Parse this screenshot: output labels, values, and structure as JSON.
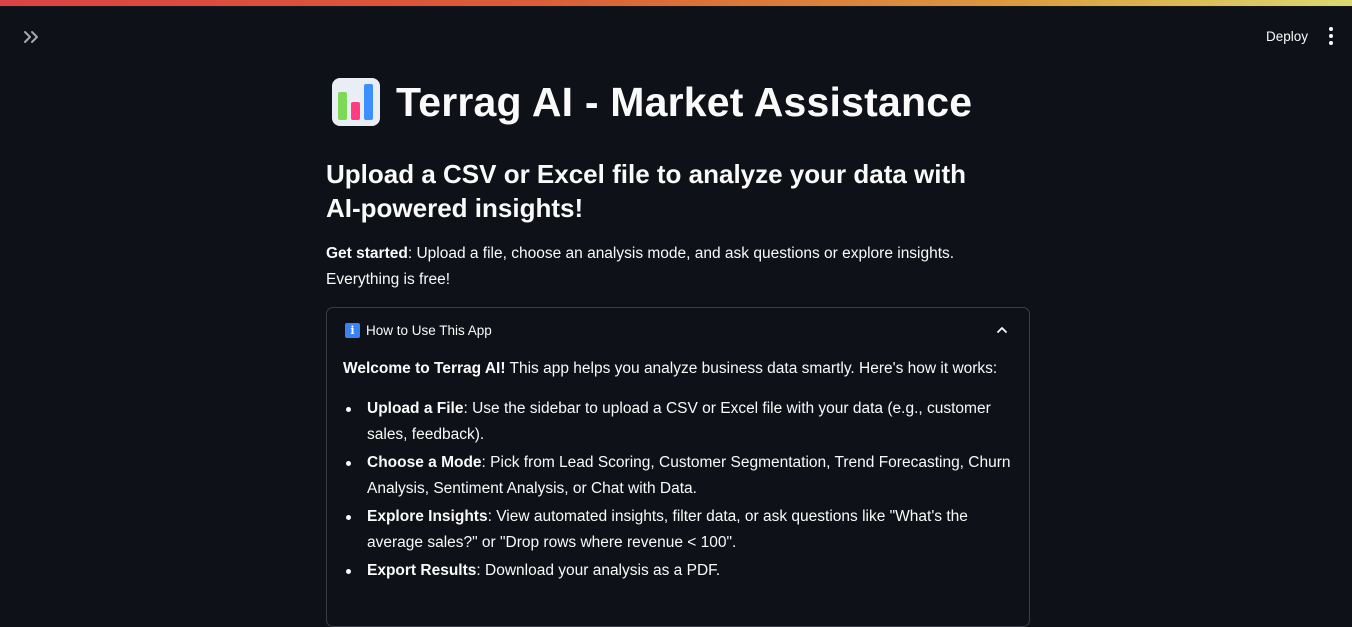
{
  "header": {
    "deploy_label": "Deploy"
  },
  "page": {
    "title": "Terrag AI - Market Assistance",
    "subtitle": "Upload a CSV or Excel file to analyze your data with AI-powered insights!",
    "intro_bold": "Get started",
    "intro_rest": ": Upload a file, choose an analysis mode, and ask questions or explore insights. Everything is free!"
  },
  "expander": {
    "title": "How to Use This App",
    "expanded": true,
    "welcome_bold": "Welcome to Terrag AI!",
    "welcome_rest": " This app helps you analyze business data smartly. Here's how it works:",
    "steps": [
      {
        "bold": "Upload a File",
        "text": ": Use the sidebar to upload a CSV or Excel file with your data (e.g., customer sales, feedback)."
      },
      {
        "bold": "Choose a Mode",
        "text": ": Pick from Lead Scoring, Customer Segmentation, Trend Forecasting, Churn Analysis, Sentiment Analysis, or Chat with Data."
      },
      {
        "bold": "Explore Insights",
        "text": ": View automated insights, filter data, or ask questions like \"What's the average sales?\" or \"Drop rows where revenue < 100\"."
      },
      {
        "bold": "Export Results",
        "text": ": Download your analysis as a PDF."
      }
    ]
  },
  "icons": {
    "sidebar_toggle": "double-chevron-right-icon",
    "menu": "vertical-dots-icon",
    "title": "bar-chart-icon",
    "info": "info-icon",
    "collapse": "chevron-up-icon"
  },
  "colors": {
    "background": "#0e1117",
    "text": "#fafafa",
    "border": "#3a3d45",
    "info_blue": "#3b82f6"
  }
}
